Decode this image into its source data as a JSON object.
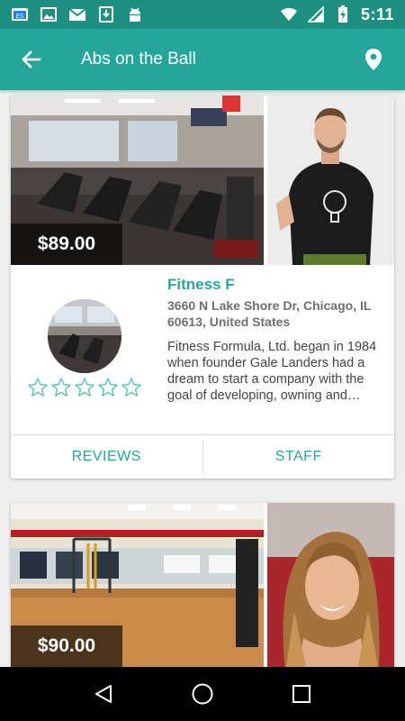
{
  "status_bar": {
    "time": "5:11",
    "icons": [
      "es-file-icon",
      "image-icon",
      "gmail-icon",
      "download-icon",
      "android-icon",
      "wifi-icon",
      "signal-icon",
      "battery-charging-icon"
    ]
  },
  "app_bar": {
    "title": "Abs on the Ball",
    "back_icon": "arrow-back-icon",
    "location_icon": "location-pin-icon"
  },
  "listings": [
    {
      "price": "$89.00",
      "name": "Fitness F",
      "address": "3660 N Lake Shore Dr, Chicago, IL 60613, United States",
      "description": "Fitness Formula, Ltd. began in 1984 when founder Gale Landers had a dream to start a company with the goal of developing, owning and operating fitness clubs",
      "rating": 0,
      "rating_max": 5,
      "actions": {
        "reviews": "REVIEWS",
        "staff": "STAFF"
      }
    },
    {
      "price": "$90.00"
    }
  ],
  "nav_bar": {
    "icons": [
      "back-triangle-icon",
      "home-circle-icon",
      "recents-square-icon"
    ]
  },
  "colors": {
    "status_bar": "#1e8f80",
    "app_bar": "#26a69a",
    "accent": "#26a69a",
    "star_outline": "#4fc3b5"
  }
}
